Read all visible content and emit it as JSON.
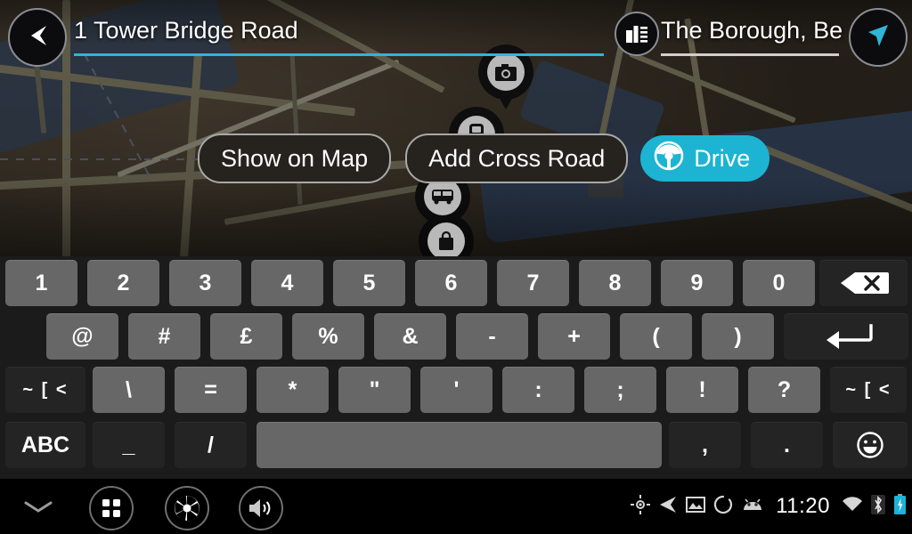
{
  "header": {
    "back_button": "back-arrow",
    "address_field": {
      "value": "1 Tower Bridge Road",
      "underline_color": "#2fb6d6"
    },
    "city_field": {
      "value": "The Borough, Ber",
      "icon": "city-buildings-icon",
      "underline_color": "#cfcfcf"
    },
    "nav_button": "navigation-arrow"
  },
  "actions": {
    "show_on_map": "Show on Map",
    "add_cross_road": "Add Cross Road",
    "drive": "Drive",
    "drive_icon": "steering-wheel-icon",
    "drive_color": "#1cb4d2"
  },
  "map": {
    "pins": [
      {
        "name": "camera-poi-pin",
        "icon": "camera-icon"
      },
      {
        "name": "train-station-poi-pin",
        "icon": "train-icon"
      },
      {
        "name": "bus-poi-pin",
        "icon": "bus-icon"
      },
      {
        "name": "shopping-poi-pin",
        "icon": "shopping-bag-icon"
      }
    ]
  },
  "keyboard": {
    "row1": [
      {
        "label": "1",
        "style": "lt"
      },
      {
        "label": "2",
        "style": "lt"
      },
      {
        "label": "3",
        "style": "lt"
      },
      {
        "label": "4",
        "style": "lt"
      },
      {
        "label": "5",
        "style": "lt"
      },
      {
        "label": "6",
        "style": "lt"
      },
      {
        "label": "7",
        "style": "lt"
      },
      {
        "label": "8",
        "style": "lt"
      },
      {
        "label": "9",
        "style": "lt"
      },
      {
        "label": "0",
        "style": "lt"
      },
      {
        "label": "",
        "style": "dk",
        "icon": "backspace-icon",
        "name": "key-backspace"
      }
    ],
    "row2": [
      {
        "label": "@",
        "style": "lt"
      },
      {
        "label": "#",
        "style": "lt"
      },
      {
        "label": "£",
        "style": "lt"
      },
      {
        "label": "%",
        "style": "lt"
      },
      {
        "label": "&",
        "style": "lt"
      },
      {
        "label": "-",
        "style": "lt"
      },
      {
        "label": "+",
        "style": "lt"
      },
      {
        "label": "(",
        "style": "lt"
      },
      {
        "label": ")",
        "style": "lt"
      },
      {
        "label": "",
        "style": "dk",
        "icon": "enter-icon",
        "name": "key-enter"
      }
    ],
    "row3": [
      {
        "label": "~ [ <",
        "style": "dk",
        "name": "key-symbols-left"
      },
      {
        "label": "\\",
        "style": "lt"
      },
      {
        "label": "=",
        "style": "lt"
      },
      {
        "label": "*",
        "style": "lt"
      },
      {
        "label": "\"",
        "style": "lt"
      },
      {
        "label": "'",
        "style": "lt"
      },
      {
        "label": ":",
        "style": "lt"
      },
      {
        "label": ";",
        "style": "lt"
      },
      {
        "label": "!",
        "style": "lt"
      },
      {
        "label": "?",
        "style": "lt"
      },
      {
        "label": "~ [ <",
        "style": "dk",
        "name": "key-symbols-right"
      }
    ],
    "row4": [
      {
        "label": "ABC",
        "style": "dk",
        "name": "key-abc"
      },
      {
        "label": "_",
        "style": "dk"
      },
      {
        "label": "/",
        "style": "dk"
      },
      {
        "label": "",
        "style": "lt",
        "name": "key-space"
      },
      {
        "label": ",",
        "style": "dk"
      },
      {
        "label": ".",
        "style": "dk"
      },
      {
        "label": "",
        "style": "dk",
        "icon": "emoji-icon",
        "name": "key-emoji"
      }
    ]
  },
  "system_bar": {
    "chevron": "chevron-down-icon",
    "apps": "apps-grid-icon",
    "camera": "camera-aperture-icon",
    "volume": "volume-up-icon",
    "clock": "11:20",
    "status_icons": [
      "gps-icon",
      "navigation-arrow-icon",
      "image-icon",
      "loading-circle-icon",
      "android-icon",
      "wifi-icon",
      "bluetooth-icon",
      "battery-charging-icon"
    ]
  }
}
